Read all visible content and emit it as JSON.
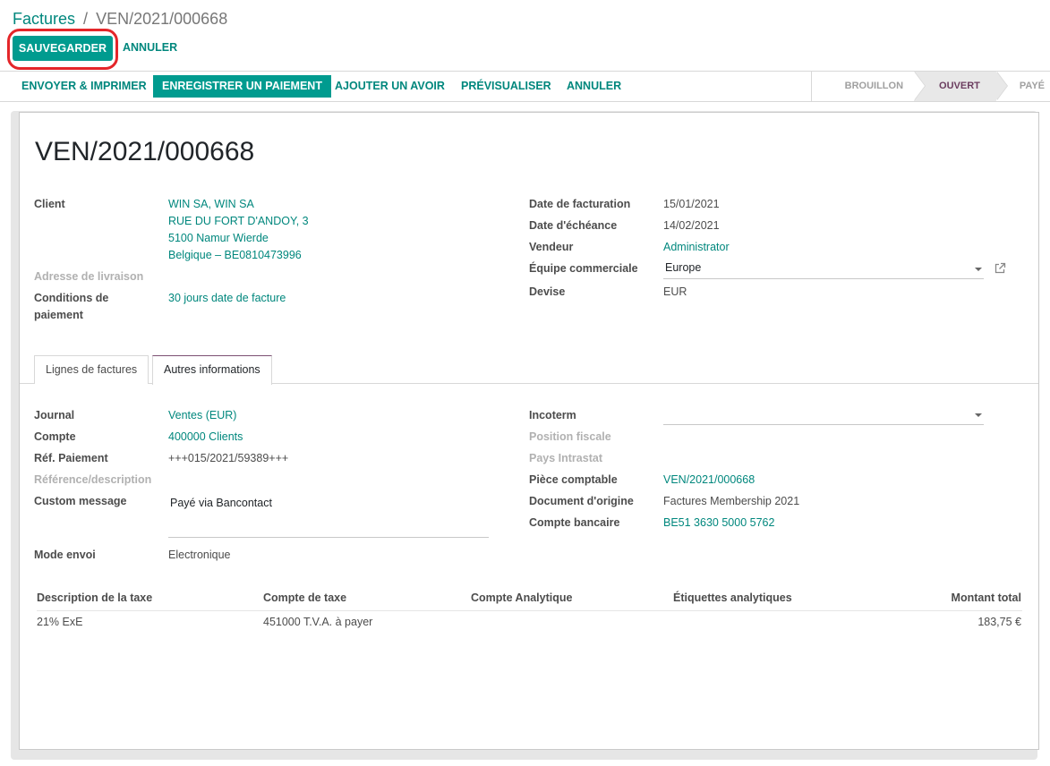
{
  "breadcrumb": {
    "parent": "Factures",
    "separator": "/",
    "current": "VEN/2021/000668"
  },
  "control_buttons": {
    "save": "SAUVEGARDER",
    "discard": "ANNULER"
  },
  "actions": [
    {
      "label": "ENVOYER & IMPRIMER",
      "primary": false
    },
    {
      "label": "ENREGISTRER UN PAIEMENT",
      "primary": true
    },
    {
      "label": "AJOUTER UN AVOIR",
      "primary": false
    },
    {
      "label": "PRÉVISUALISER",
      "primary": false
    },
    {
      "label": "ANNULER",
      "primary": false
    }
  ],
  "status_steps": [
    {
      "label": "BROUILLON",
      "active": false
    },
    {
      "label": "OUVERT",
      "active": true
    },
    {
      "label": "PAYÉ",
      "active": false
    }
  ],
  "document": {
    "title": "VEN/2021/000668"
  },
  "left_fields": {
    "client_label": "Client",
    "client_lines": [
      "WIN SA, WIN SA",
      "RUE DU FORT D'ANDOY, 3",
      "5100 Namur Wierde",
      "Belgique – BE0810473996"
    ],
    "delivery_label": "Adresse de livraison",
    "payment_terms_label_1": "Conditions de",
    "payment_terms_label_2": "paiement",
    "payment_terms_value": "30 jours date de facture"
  },
  "right_fields": {
    "invoice_date_label": "Date de facturation",
    "invoice_date": "15/01/2021",
    "due_date_label": "Date d'échéance",
    "due_date": "14/02/2021",
    "salesperson_label": "Vendeur",
    "salesperson": "Administrator",
    "sales_team_label": "Équipe commerciale",
    "sales_team": "Europe",
    "currency_label": "Devise",
    "currency": "EUR"
  },
  "tabs": [
    {
      "label": "Lignes de factures",
      "active": false
    },
    {
      "label": "Autres informations",
      "active": true
    }
  ],
  "other_info": {
    "left": {
      "journal_label": "Journal",
      "journal": "Ventes (EUR)",
      "account_label": "Compte",
      "account": "400000 Clients",
      "payment_ref_label": "Réf. Paiement",
      "payment_ref": "+++015/2021/59389+++",
      "reference_label": "Référence/description",
      "custom_message_label": "Custom message",
      "custom_message": "Payé via Bancontact",
      "send_mode_label": "Mode envoi",
      "send_mode": "Electronique"
    },
    "right": {
      "incoterm_label": "Incoterm",
      "incoterm": "",
      "fiscal_position_label": "Position fiscale",
      "intrastat_country_label": "Pays Intrastat",
      "journal_entry_label": "Pièce comptable",
      "journal_entry": "VEN/2021/000668",
      "origin_label": "Document d'origine",
      "origin": "Factures Membership 2021",
      "bank_account_label": "Compte bancaire",
      "bank_account": "BE51 3630 5000 5762"
    }
  },
  "tax_table": {
    "headers": [
      "Description de la taxe",
      "Compte de taxe",
      "Compte Analytique",
      "Étiquettes analytiques",
      "Montant total"
    ],
    "rows": [
      [
        "21% ExE",
        "451000 T.V.A. à payer",
        "",
        "",
        "183,75 €"
      ]
    ]
  },
  "colors": {
    "accent": "#009b8f",
    "link": "#00877d",
    "active_step": "#6b3d5f",
    "highlight": "#e4262a"
  }
}
